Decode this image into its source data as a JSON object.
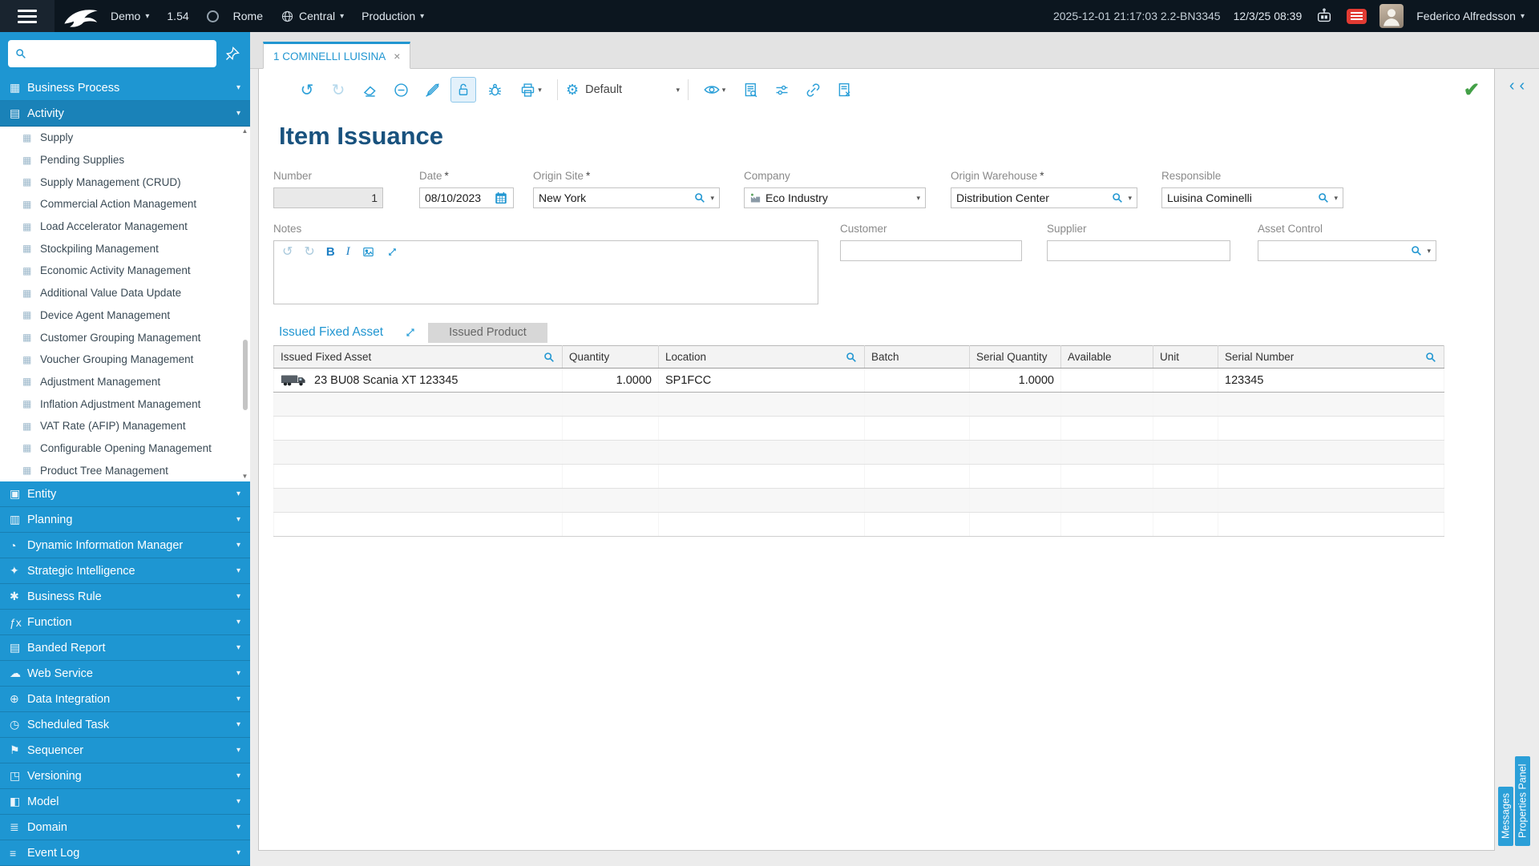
{
  "ui": {
    "caret_down": "▾",
    "chevron_left": "‹",
    "close": "×",
    "check": "✔",
    "scroll_up": "▲",
    "scroll_down": "▼",
    "undo": "↺",
    "redo": "↻",
    "gear": "⚙"
  },
  "colors": {
    "accent": "#2196d1",
    "topbar_bg": "#0c161f",
    "sidebar_bg": "#1e96d2",
    "success": "#43a047",
    "tab_inactive_bg": "#d7d7d7",
    "alert_badge": "#e23b33"
  },
  "topbar": {
    "environment": {
      "name": "Demo",
      "version": "1.54",
      "location": "Rome",
      "region": "Central",
      "mode": "Production"
    },
    "status": {
      "build_info": "2025-12-01 21:17:03 2.2-BN3345",
      "local_datetime": "12/3/25 08:39"
    },
    "user": {
      "name": "Federico Alfredsson"
    }
  },
  "sidebar": {
    "search": {
      "value": "",
      "placeholder": ""
    },
    "menu": [
      {
        "label": "Business Process",
        "icon": "business-process-icon",
        "glyph": "▦"
      },
      {
        "label": "Activity",
        "icon": "activity-icon",
        "glyph": "▤"
      }
    ],
    "activity_submenu": [
      {
        "label": "Supply",
        "icon": "module-icon",
        "glyph": "▦"
      },
      {
        "label": "Pending Supplies",
        "icon": "module-icon",
        "glyph": "▦"
      },
      {
        "label": "Supply Management (CRUD)",
        "icon": "module-icon",
        "glyph": "▦"
      },
      {
        "label": "Commercial Action Management",
        "icon": "module-icon",
        "glyph": "▦"
      },
      {
        "label": "Load Accelerator Management",
        "icon": "module-icon",
        "glyph": "▦"
      },
      {
        "label": "Stockpiling Management",
        "icon": "module-icon",
        "glyph": "▦"
      },
      {
        "label": "Economic Activity Management",
        "icon": "module-icon",
        "glyph": "▦"
      },
      {
        "label": "Additional Value Data Update",
        "icon": "module-icon",
        "glyph": "▦"
      },
      {
        "label": "Device Agent Management",
        "icon": "module-icon",
        "glyph": "▦"
      },
      {
        "label": "Customer Grouping Management",
        "icon": "module-icon",
        "glyph": "▦"
      },
      {
        "label": "Voucher Grouping Management",
        "icon": "module-icon",
        "glyph": "▦"
      },
      {
        "label": "Adjustment Management",
        "icon": "module-icon",
        "glyph": "▦"
      },
      {
        "label": "Inflation Adjustment Management",
        "icon": "module-icon",
        "glyph": "▦"
      },
      {
        "label": "VAT Rate (AFIP) Management",
        "icon": "module-icon",
        "glyph": "▦"
      },
      {
        "label": "Configurable Opening Management",
        "icon": "module-icon",
        "glyph": "▦"
      },
      {
        "label": "Product Tree Management",
        "icon": "module-icon",
        "glyph": "▦"
      }
    ],
    "menu_bottom": [
      {
        "label": "Entity",
        "icon": "entity-icon",
        "glyph": "▣"
      },
      {
        "label": "Planning",
        "icon": "planning-icon",
        "glyph": "▥"
      },
      {
        "label": "Dynamic Information Manager",
        "icon": "dynamic-info-icon",
        "glyph": "◔"
      },
      {
        "label": "Strategic Intelligence",
        "icon": "strategic-intelligence-icon",
        "glyph": "✦"
      },
      {
        "label": "Business Rule",
        "icon": "business-rule-icon",
        "glyph": "✱"
      },
      {
        "label": "Function",
        "icon": "function-icon",
        "glyph": "ƒx"
      },
      {
        "label": "Banded Report",
        "icon": "banded-report-icon",
        "glyph": "▤"
      },
      {
        "label": "Web Service",
        "icon": "web-service-icon",
        "glyph": "☁"
      },
      {
        "label": "Data Integration",
        "icon": "data-integration-icon",
        "glyph": "⊕"
      },
      {
        "label": "Scheduled Task",
        "icon": "scheduled-task-icon",
        "glyph": "◷"
      },
      {
        "label": "Sequencer",
        "icon": "sequencer-icon",
        "glyph": "⚑"
      },
      {
        "label": "Versioning",
        "icon": "versioning-icon",
        "glyph": "◳"
      },
      {
        "label": "Model",
        "icon": "model-icon",
        "glyph": "◧"
      },
      {
        "label": "Domain",
        "icon": "domain-icon",
        "glyph": "≣"
      },
      {
        "label": "Event Log",
        "icon": "event-log-icon",
        "glyph": "≡"
      }
    ]
  },
  "tabs": {
    "document_title": "1 COMINELLI LUISINA"
  },
  "toolbar": {
    "preset_label": "Default",
    "icons": [
      "undo",
      "redo",
      "eraser",
      "minus-circle",
      "no-edit",
      "lock-open",
      "debug",
      "print",
      "view-options",
      "print-preview",
      "sliders",
      "link",
      "remove-document",
      "confirm-check"
    ]
  },
  "page": {
    "title": "Item Issuance",
    "fields": {
      "number": {
        "label": "Number",
        "value": "1"
      },
      "date": {
        "label": "Date",
        "req": "*",
        "value": "08/10/2023"
      },
      "origin_site": {
        "label": "Origin Site",
        "req": "*",
        "value": "New York"
      },
      "company": {
        "label": "Company",
        "value": "Eco Industry"
      },
      "origin_warehouse": {
        "label": "Origin Warehouse",
        "req": "*",
        "value": "Distribution Center"
      },
      "responsible": {
        "label": "Responsible",
        "value": "Luisina Cominelli"
      },
      "notes": {
        "label": "Notes",
        "value": ""
      },
      "customer": {
        "label": "Customer",
        "value": ""
      },
      "supplier": {
        "label": "Supplier",
        "value": ""
      },
      "asset_control": {
        "label": "Asset Control",
        "value": ""
      }
    },
    "editor": {
      "bold": "B",
      "italic": "I"
    },
    "detail_tabs": [
      {
        "label": "Issued Fixed Asset"
      },
      {
        "label": "Issued Product"
      }
    ],
    "table": {
      "columns": [
        "Issued Fixed Asset",
        "Quantity",
        "Location",
        "Batch",
        "Serial Quantity",
        "Available",
        "Unit",
        "Serial Number"
      ],
      "rows": [
        {
          "asset": "23 BU08 Scania XT 123345",
          "quantity": "1.0000",
          "location": "SP1FCC",
          "batch": "",
          "serial_quantity": "1.0000",
          "available": "",
          "unit": "",
          "serial_number": "123345"
        }
      ]
    }
  },
  "right_panel": {
    "tabs": [
      "Messages",
      "Properties Panel"
    ]
  }
}
